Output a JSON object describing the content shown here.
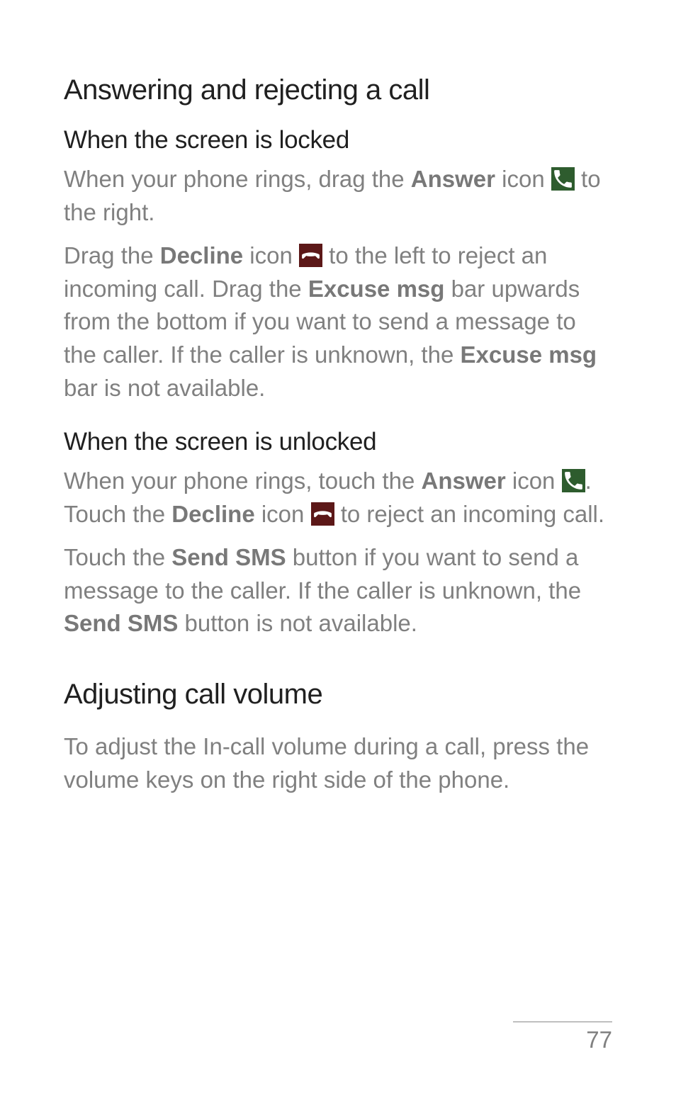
{
  "section1": {
    "title": "Answering and rejecting a call",
    "locked": {
      "heading": "When the screen is locked",
      "p1_a": "When your phone rings, drag the ",
      "p1_b": "Answer",
      "p1_c": " icon ",
      "p1_d": " to the right.",
      "p2_a": "Drag the ",
      "p2_b": "Decline",
      "p2_c": " icon ",
      "p2_d": " to the left to reject an incoming call. Drag the ",
      "p2_e": "Excuse msg",
      "p2_f": " bar upwards from the bottom if you want to send a message to the caller. If the caller is unknown, the ",
      "p2_g": "Excuse msg",
      "p2_h": " bar is not available."
    },
    "unlocked": {
      "heading": "When the screen is unlocked",
      "p1_a": "When your phone rings, touch the ",
      "p1_b": "Answer",
      "p1_c": " icon ",
      "p1_d": ". Touch the ",
      "p1_e": "Decline",
      "p1_f": " icon ",
      "p1_g": " to reject an incoming call.",
      "p2_a": "Touch the ",
      "p2_b": "Send SMS",
      "p2_c": " button if you want to send a message to the caller. If the caller is unknown, the ",
      "p2_d": "Send SMS",
      "p2_e": " button is not available."
    }
  },
  "section2": {
    "title": "Adjusting call volume",
    "p1": "To adjust the In-call volume during a call, press the volume keys on the right side of the phone."
  },
  "page_number": "77"
}
